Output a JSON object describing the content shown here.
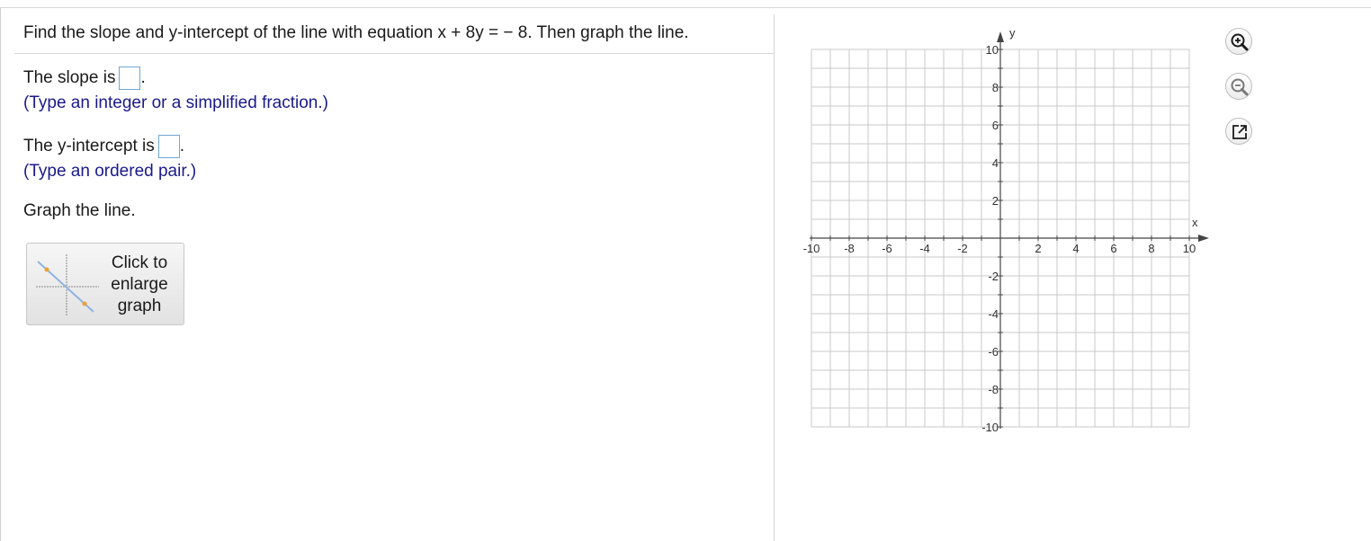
{
  "question": {
    "text": "Find the slope and y-intercept of the line with equation x + 8y = − 8. Then graph the line."
  },
  "slope": {
    "prefix": "The slope is",
    "suffix": ".",
    "value": "",
    "hint": "(Type an integer or a simplified fraction.)"
  },
  "intercept": {
    "prefix": "The y-intercept is",
    "suffix": ".",
    "value": "",
    "hint": "(Type an ordered pair.)"
  },
  "graph_prompt": "Graph the line.",
  "enlarge_button": {
    "line1": "Click to",
    "line2": "enlarge",
    "line3": "graph"
  },
  "graph": {
    "x_axis_label": "x",
    "y_axis_label": "y",
    "x_ticks": [
      "-10",
      "-8",
      "-6",
      "-4",
      "-2",
      "2",
      "4",
      "6",
      "8",
      "10"
    ],
    "y_ticks": [
      "10",
      "8",
      "6",
      "4",
      "2",
      "-2",
      "-4",
      "-6",
      "-8",
      "-10"
    ],
    "x_range": [
      -10,
      10
    ],
    "y_range": [
      -10,
      10
    ],
    "grid": true
  },
  "tools": [
    {
      "icon": "zoom-in-icon"
    },
    {
      "icon": "zoom-out-icon"
    },
    {
      "icon": "pop-out-icon"
    }
  ],
  "colors": {
    "hint_text": "#1a1a8a",
    "input_border": "#6fa8d6",
    "grid": "#c8c8c8",
    "axis": "#444444"
  }
}
